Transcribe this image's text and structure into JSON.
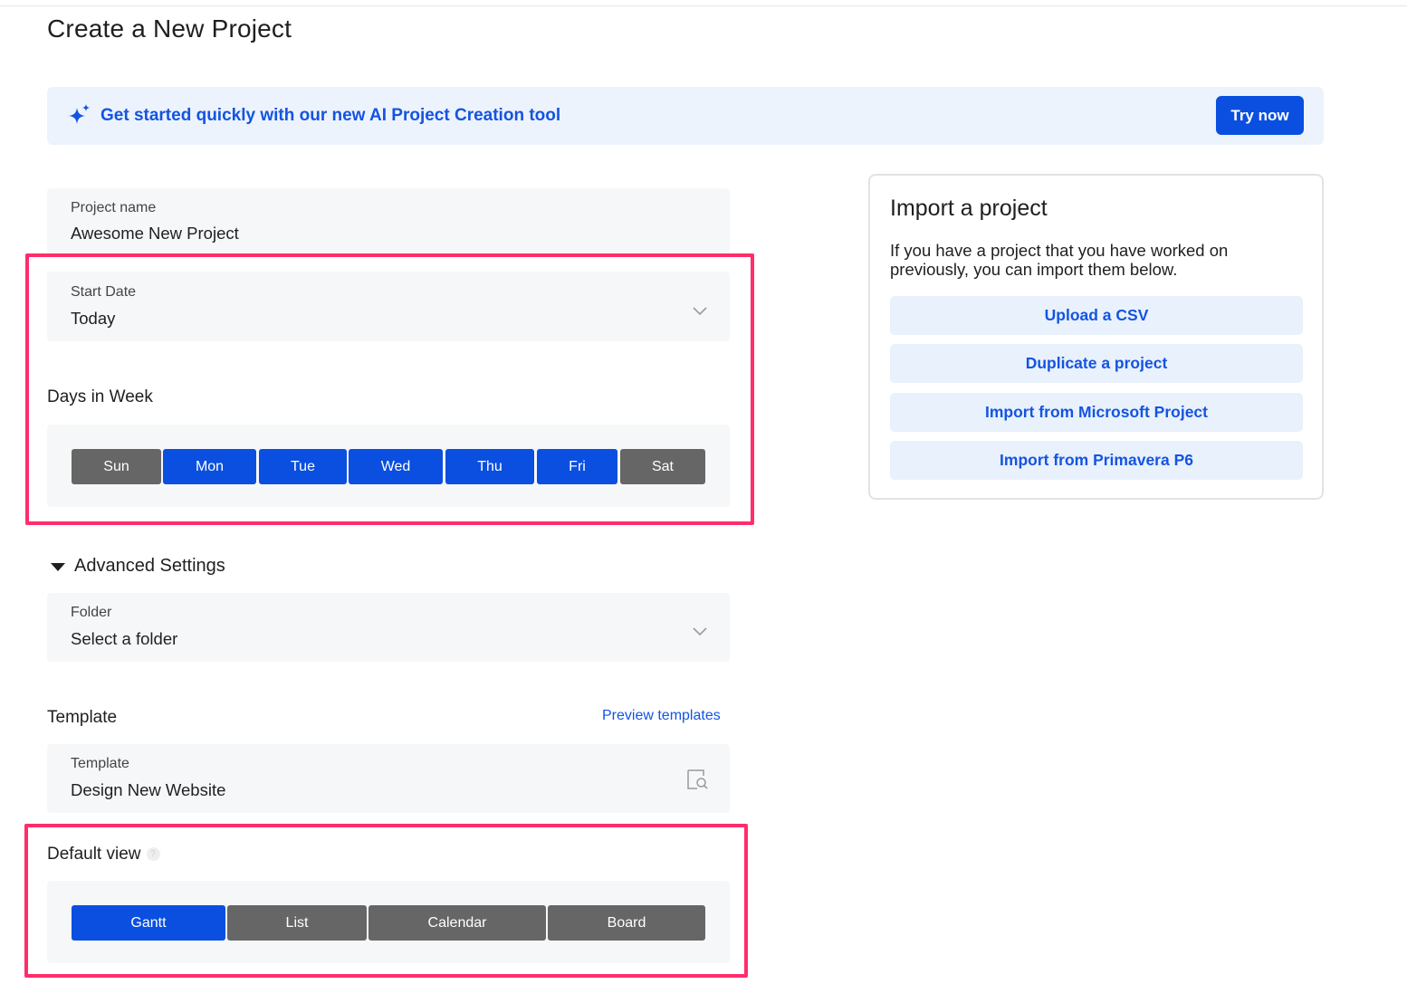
{
  "page": {
    "title": "Create a New Project"
  },
  "ai_banner": {
    "icon": "sparkle-icon",
    "text": "Get started quickly with our new AI Project Creation tool",
    "button_label": "Try now"
  },
  "project_name": {
    "label": "Project name",
    "value": "Awesome New Project"
  },
  "start_date": {
    "label": "Start Date",
    "value": "Today",
    "icon": "chevron-down-icon"
  },
  "days_in_week": {
    "label": "Days in Week",
    "days": [
      {
        "label": "Sun",
        "selected": false
      },
      {
        "label": "Mon",
        "selected": true
      },
      {
        "label": "Tue",
        "selected": true
      },
      {
        "label": "Wed",
        "selected": true
      },
      {
        "label": "Thu",
        "selected": true
      },
      {
        "label": "Fri",
        "selected": true
      },
      {
        "label": "Sat",
        "selected": false
      }
    ]
  },
  "advanced_settings": {
    "label": "Advanced Settings",
    "expanded": true
  },
  "folder": {
    "label": "Folder",
    "value": "Select a folder",
    "icon": "chevron-down-icon"
  },
  "template_section": {
    "label": "Template",
    "preview_link": "Preview templates",
    "field_label": "Template",
    "field_value": "Design New Website",
    "icon": "template-search-icon"
  },
  "default_view": {
    "label": "Default view",
    "help_icon": "help-icon",
    "help_glyph": "?",
    "options": [
      {
        "label": "Gantt",
        "selected": true
      },
      {
        "label": "List",
        "selected": false
      },
      {
        "label": "Calendar",
        "selected": false
      },
      {
        "label": "Board",
        "selected": false
      }
    ]
  },
  "import": {
    "title": "Import a project",
    "description": "If you have a project that you have worked on previously, you can import them below.",
    "buttons": [
      "Upload a CSV",
      "Duplicate a project",
      "Import from Microsoft Project",
      "Import from Primavera P6"
    ]
  },
  "colors": {
    "primary": "#0a4fe0",
    "link": "#1454e0",
    "unselected": "#666666",
    "highlight": "#ff2e6b",
    "banner_bg": "#edf3fd",
    "field_bg": "#f6f7f9"
  }
}
